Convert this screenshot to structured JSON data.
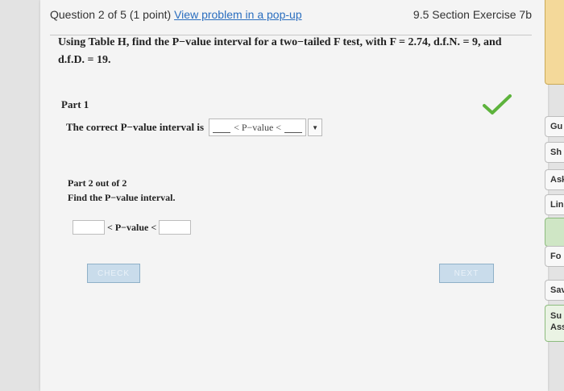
{
  "header": {
    "question_number": "Question 2 of 5 (1 point)",
    "popup_link": "View problem in a pop-up",
    "exercise": "9.5 Section Exercise 7b"
  },
  "problem": {
    "line1": "Using Table H, find the P−value interval for a two−tailed F test, with F = 2.74, d.f.N. = 9, and",
    "line2": "d.f.D. = 19."
  },
  "part1": {
    "title": "Part 1",
    "label": "The correct P−value interval is",
    "answer_text": "< P−value <"
  },
  "part2": {
    "title": "Part 2 out of 2",
    "instruction": "Find the P−value interval.",
    "middle_label": "< P−value <",
    "lower_value": "",
    "upper_value": ""
  },
  "buttons": {
    "check": "CHECK",
    "next": "NEXT"
  },
  "sidebar": {
    "items": [
      "Gu",
      "Sh",
      "Ask",
      "Link",
      "Fo",
      "Save"
    ],
    "submit_line1": "Su",
    "submit_line2": "Assi"
  },
  "colors": {
    "link": "#2a6ebf",
    "check_icon": "#5db33c",
    "button": "#c9dceb"
  },
  "icons": {
    "part1_status": "checkmark-icon",
    "dropdown": "triangle-down-icon"
  }
}
